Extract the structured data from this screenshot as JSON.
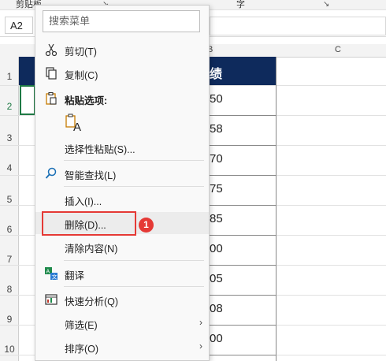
{
  "ribbon": {
    "item1": "剪贴板",
    "item1_mark": "↘",
    "item2": "字",
    "item2_mark": "↘"
  },
  "formula_bar": {
    "name_box": "A2",
    "formula": ""
  },
  "columns": [
    "B",
    "C"
  ],
  "rows": [
    "1",
    "2",
    "3",
    "4",
    "5",
    "6",
    "7",
    "8",
    "9",
    "10"
  ],
  "sheet": {
    "header_cell": "绩",
    "values": [
      "50",
      "58",
      "70",
      "75",
      "85",
      "00",
      "05",
      "08",
      "00"
    ]
  },
  "menu": {
    "search_placeholder": "搜索菜单",
    "items": [
      {
        "label": "剪切(T)",
        "icon": "scissors-icon"
      },
      {
        "label": "复制(C)",
        "icon": "copy-icon"
      },
      {
        "label": "粘贴选项:",
        "icon": "clipboard-icon"
      },
      {
        "label": "选择性粘贴(S)...",
        "icon": ""
      },
      {
        "label": "智能查找(L)",
        "icon": "search-icon"
      },
      {
        "label": "插入(I)...",
        "icon": ""
      },
      {
        "label": "删除(D)...",
        "icon": ""
      },
      {
        "label": "清除内容(N)",
        "icon": ""
      },
      {
        "label": "翻译",
        "icon": "translate-icon"
      },
      {
        "label": "快速分析(Q)",
        "icon": "quick-analysis-icon"
      },
      {
        "label": "筛选(E)",
        "icon": ""
      },
      {
        "label": "排序(O)",
        "icon": ""
      }
    ],
    "paste_option_glyph": "A"
  },
  "annotation": {
    "badge": "1",
    "highlight_color": "#e53935"
  },
  "colors": {
    "table_header": "#0e2a5c",
    "selection": "#1f7a45"
  }
}
